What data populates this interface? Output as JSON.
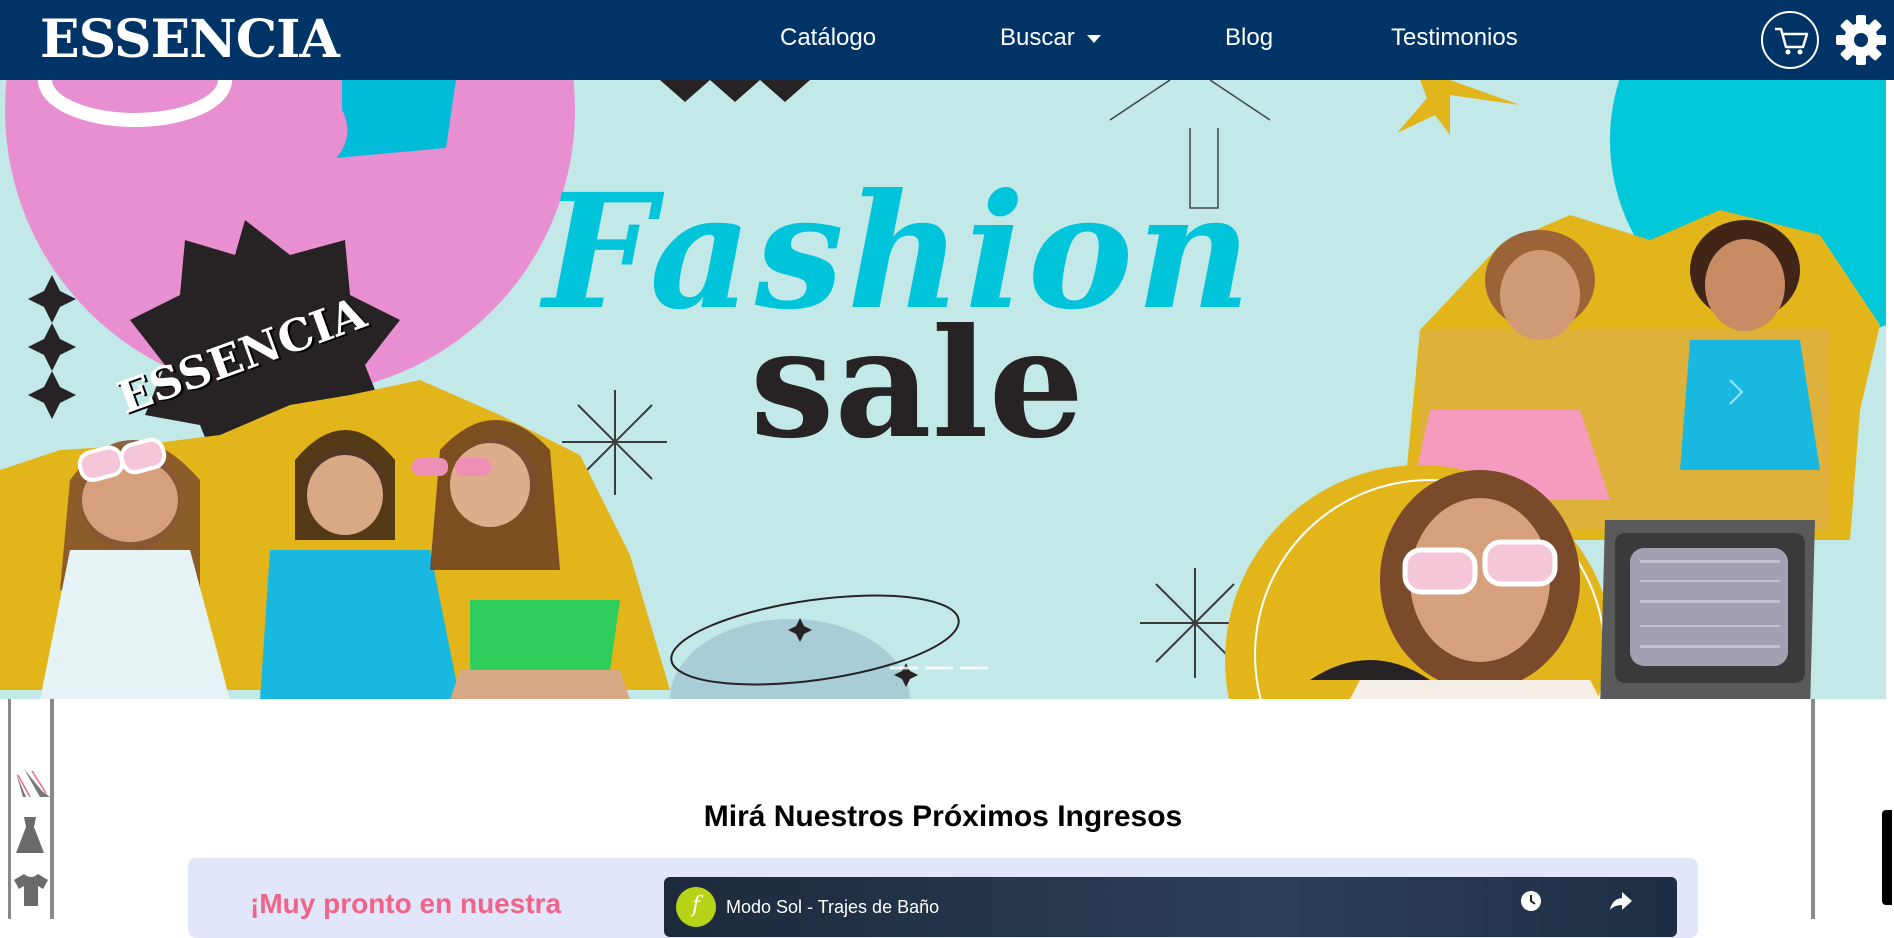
{
  "navbar": {
    "brand": "ESSENCIA",
    "links": [
      "Catálogo",
      "Buscar",
      "Blog",
      "Testimonios"
    ],
    "colors": {
      "background": "#003366",
      "text": "#ffffff"
    }
  },
  "hero": {
    "headline": "Fashion",
    "subheadline": "sale",
    "badge": "ESSENCIA",
    "colors": {
      "background": "#c3e8e8",
      "headline": "#00c4d9",
      "subheadline": "#272324",
      "badge": "#272324",
      "accent_pink": "#e78fd1",
      "accent_yellow": "#e2b51a"
    }
  },
  "side_icons": [
    "heels-icon",
    "dress-icon",
    "tshirt-icon"
  ],
  "section": {
    "title": "Mirá Nuestros Próximos Ingresos",
    "promo_text": "¡Muy pronto en nuestra",
    "video": {
      "title": "Modo Sol - Trajes de Baño",
      "channel_initial": "f"
    }
  }
}
